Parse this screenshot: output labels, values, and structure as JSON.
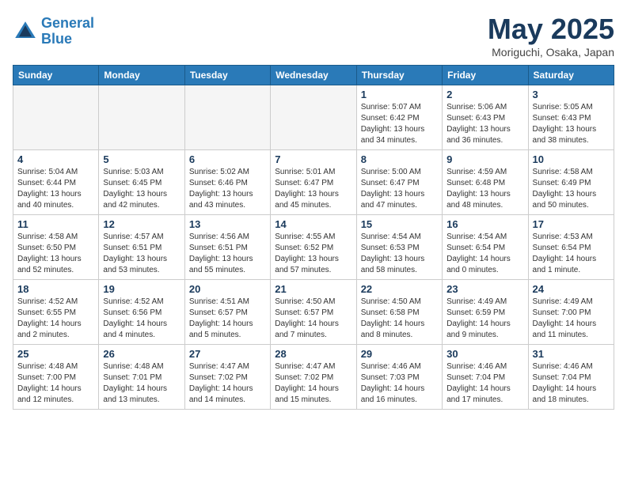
{
  "header": {
    "logo_line1": "General",
    "logo_line2": "Blue",
    "month": "May 2025",
    "location": "Moriguchi, Osaka, Japan"
  },
  "days_of_week": [
    "Sunday",
    "Monday",
    "Tuesday",
    "Wednesday",
    "Thursday",
    "Friday",
    "Saturday"
  ],
  "weeks": [
    [
      {
        "day": "",
        "info": ""
      },
      {
        "day": "",
        "info": ""
      },
      {
        "day": "",
        "info": ""
      },
      {
        "day": "",
        "info": ""
      },
      {
        "day": "1",
        "info": "Sunrise: 5:07 AM\nSunset: 6:42 PM\nDaylight: 13 hours\nand 34 minutes."
      },
      {
        "day": "2",
        "info": "Sunrise: 5:06 AM\nSunset: 6:43 PM\nDaylight: 13 hours\nand 36 minutes."
      },
      {
        "day": "3",
        "info": "Sunrise: 5:05 AM\nSunset: 6:43 PM\nDaylight: 13 hours\nand 38 minutes."
      }
    ],
    [
      {
        "day": "4",
        "info": "Sunrise: 5:04 AM\nSunset: 6:44 PM\nDaylight: 13 hours\nand 40 minutes."
      },
      {
        "day": "5",
        "info": "Sunrise: 5:03 AM\nSunset: 6:45 PM\nDaylight: 13 hours\nand 42 minutes."
      },
      {
        "day": "6",
        "info": "Sunrise: 5:02 AM\nSunset: 6:46 PM\nDaylight: 13 hours\nand 43 minutes."
      },
      {
        "day": "7",
        "info": "Sunrise: 5:01 AM\nSunset: 6:47 PM\nDaylight: 13 hours\nand 45 minutes."
      },
      {
        "day": "8",
        "info": "Sunrise: 5:00 AM\nSunset: 6:47 PM\nDaylight: 13 hours\nand 47 minutes."
      },
      {
        "day": "9",
        "info": "Sunrise: 4:59 AM\nSunset: 6:48 PM\nDaylight: 13 hours\nand 48 minutes."
      },
      {
        "day": "10",
        "info": "Sunrise: 4:58 AM\nSunset: 6:49 PM\nDaylight: 13 hours\nand 50 minutes."
      }
    ],
    [
      {
        "day": "11",
        "info": "Sunrise: 4:58 AM\nSunset: 6:50 PM\nDaylight: 13 hours\nand 52 minutes."
      },
      {
        "day": "12",
        "info": "Sunrise: 4:57 AM\nSunset: 6:51 PM\nDaylight: 13 hours\nand 53 minutes."
      },
      {
        "day": "13",
        "info": "Sunrise: 4:56 AM\nSunset: 6:51 PM\nDaylight: 13 hours\nand 55 minutes."
      },
      {
        "day": "14",
        "info": "Sunrise: 4:55 AM\nSunset: 6:52 PM\nDaylight: 13 hours\nand 57 minutes."
      },
      {
        "day": "15",
        "info": "Sunrise: 4:54 AM\nSunset: 6:53 PM\nDaylight: 13 hours\nand 58 minutes."
      },
      {
        "day": "16",
        "info": "Sunrise: 4:54 AM\nSunset: 6:54 PM\nDaylight: 14 hours\nand 0 minutes."
      },
      {
        "day": "17",
        "info": "Sunrise: 4:53 AM\nSunset: 6:54 PM\nDaylight: 14 hours\nand 1 minute."
      }
    ],
    [
      {
        "day": "18",
        "info": "Sunrise: 4:52 AM\nSunset: 6:55 PM\nDaylight: 14 hours\nand 2 minutes."
      },
      {
        "day": "19",
        "info": "Sunrise: 4:52 AM\nSunset: 6:56 PM\nDaylight: 14 hours\nand 4 minutes."
      },
      {
        "day": "20",
        "info": "Sunrise: 4:51 AM\nSunset: 6:57 PM\nDaylight: 14 hours\nand 5 minutes."
      },
      {
        "day": "21",
        "info": "Sunrise: 4:50 AM\nSunset: 6:57 PM\nDaylight: 14 hours\nand 7 minutes."
      },
      {
        "day": "22",
        "info": "Sunrise: 4:50 AM\nSunset: 6:58 PM\nDaylight: 14 hours\nand 8 minutes."
      },
      {
        "day": "23",
        "info": "Sunrise: 4:49 AM\nSunset: 6:59 PM\nDaylight: 14 hours\nand 9 minutes."
      },
      {
        "day": "24",
        "info": "Sunrise: 4:49 AM\nSunset: 7:00 PM\nDaylight: 14 hours\nand 11 minutes."
      }
    ],
    [
      {
        "day": "25",
        "info": "Sunrise: 4:48 AM\nSunset: 7:00 PM\nDaylight: 14 hours\nand 12 minutes."
      },
      {
        "day": "26",
        "info": "Sunrise: 4:48 AM\nSunset: 7:01 PM\nDaylight: 14 hours\nand 13 minutes."
      },
      {
        "day": "27",
        "info": "Sunrise: 4:47 AM\nSunset: 7:02 PM\nDaylight: 14 hours\nand 14 minutes."
      },
      {
        "day": "28",
        "info": "Sunrise: 4:47 AM\nSunset: 7:02 PM\nDaylight: 14 hours\nand 15 minutes."
      },
      {
        "day": "29",
        "info": "Sunrise: 4:46 AM\nSunset: 7:03 PM\nDaylight: 14 hours\nand 16 minutes."
      },
      {
        "day": "30",
        "info": "Sunrise: 4:46 AM\nSunset: 7:04 PM\nDaylight: 14 hours\nand 17 minutes."
      },
      {
        "day": "31",
        "info": "Sunrise: 4:46 AM\nSunset: 7:04 PM\nDaylight: 14 hours\nand 18 minutes."
      }
    ]
  ]
}
